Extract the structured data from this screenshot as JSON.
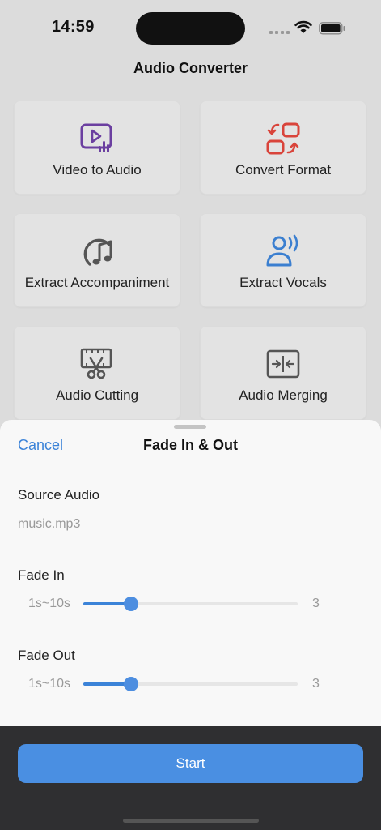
{
  "status_bar": {
    "time": "14:59"
  },
  "header": {
    "title": "Audio Converter"
  },
  "tools": [
    {
      "label": "Video to Audio",
      "icon": "video-to-audio-icon",
      "color": "#6b3fa0"
    },
    {
      "label": "Convert Format",
      "icon": "convert-format-icon",
      "color": "#d9443b"
    },
    {
      "label": "Extract Accompaniment",
      "icon": "music-note-icon",
      "color": "#555555"
    },
    {
      "label": "Extract Vocals",
      "icon": "vocals-icon",
      "color": "#3b7fd0"
    },
    {
      "label": "Audio Cutting",
      "icon": "scissors-film-icon",
      "color": "#555555"
    },
    {
      "label": "Audio Merging",
      "icon": "merge-icon",
      "color": "#555555"
    }
  ],
  "sheet": {
    "cancel_label": "Cancel",
    "title": "Fade In & Out",
    "source_label": "Source Audio",
    "source_file": "music.mp3",
    "fade_in": {
      "label": "Fade In",
      "range": "1s~10s",
      "value": "3",
      "min": 1,
      "max": 10,
      "current": 3
    },
    "fade_out": {
      "label": "Fade Out",
      "range": "1s~10s",
      "value": "3",
      "min": 1,
      "max": 10,
      "current": 3
    }
  },
  "footer": {
    "start_label": "Start"
  },
  "colors": {
    "accent": "#3b83d8",
    "button": "#4a8fe2"
  }
}
